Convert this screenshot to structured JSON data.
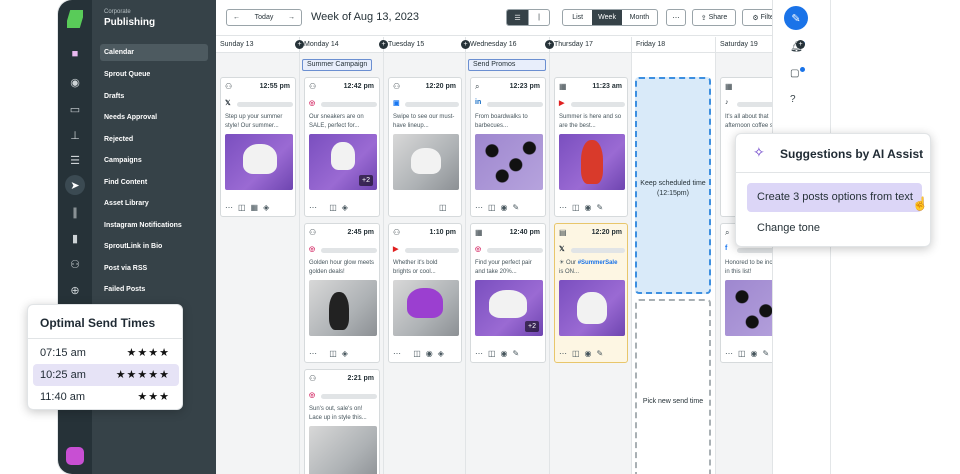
{
  "nav": {
    "org": "Corporate",
    "title": "Publishing",
    "items": [
      "Calendar",
      "Sprout Queue",
      "Drafts",
      "Needs Approval",
      "Rejected",
      "Campaigns",
      "Find Content",
      "Asset Library",
      "Instagram Notifications",
      "SproutLink in Bio",
      "Post via RSS",
      "Failed Posts"
    ]
  },
  "toolbar": {
    "today": "Today",
    "week_label": "Week of Aug 13, 2023",
    "view_list": "List",
    "view_week": "Week",
    "view_month": "Month",
    "share": "Share",
    "filters": "Filters"
  },
  "days": [
    {
      "label": "Sunday 13"
    },
    {
      "label": "Monday 14",
      "tag": "Summer Campaign"
    },
    {
      "label": "Tuesday 15"
    },
    {
      "label": "Wednesday 16",
      "tag": "Send Promos"
    },
    {
      "label": "Thursday 17"
    },
    {
      "label": "Friday 18"
    },
    {
      "label": "Saturday 19"
    }
  ],
  "posts": {
    "sun1": {
      "time": "12:55 pm",
      "network": "𝕏",
      "caption": "Step up your summer style! Our summer..."
    },
    "mon1": {
      "time": "12:42 pm",
      "network": "◎",
      "caption": "Our sneakers are on SALE, perfect for...",
      "more": "+2"
    },
    "mon2": {
      "time": "2:45 pm",
      "network": "◎",
      "caption": "Golden hour glow meets golden deals!"
    },
    "mon3": {
      "time": "2:21 pm",
      "network": "◎",
      "caption": "Sun's out, sale's on! Lace up in style this..."
    },
    "tue1": {
      "time": "12:20 pm",
      "network": "▣",
      "caption": "Swipe to see our must-have lineup..."
    },
    "tue2": {
      "time": "1:10 pm",
      "network": "▶",
      "caption": "Whether it's bold brights or cool..."
    },
    "wed1": {
      "time": "12:23 pm",
      "network": "in",
      "caption": "From boardwalks to barbecues..."
    },
    "wed2": {
      "time": "12:40 pm",
      "network": "◎",
      "caption": "Find your perfect pair and take 20%...",
      "more": "+2"
    },
    "thu1": {
      "time": "11:23 am",
      "network": "▶",
      "caption": "Summer is here and so are the best..."
    },
    "thu2": {
      "time": "12:20 pm",
      "network": "𝕏",
      "caption": "☀ Our ",
      "hashtag": "#SummerSale",
      "caption2": " is ON..."
    },
    "sat1": {
      "time": "",
      "network": "♪",
      "caption": "It's all about that afternoon coffee swirl"
    },
    "sat2": {
      "time": "",
      "network": "f",
      "caption": "Honored to be included in this list!"
    }
  },
  "slots": {
    "keep": "Keep scheduled time (12:15pm)",
    "pick": "Pick new send time"
  },
  "ai": {
    "title": "Suggestions by AI Assist",
    "opt1": "Create 3 posts options from text",
    "opt2": "Change tone"
  },
  "optimal": {
    "title": "Optimal Send Times",
    "rows": [
      {
        "time": "07:15 am",
        "stars": "★★★★"
      },
      {
        "time": "10:25 am",
        "stars": "★★★★★"
      },
      {
        "time": "11:40 am",
        "stars": "★★★"
      }
    ]
  },
  "colors": {
    "accent": "#1a73e8",
    "nav_bg": "#364248",
    "rail_bg": "#263238",
    "ai_highlight": "#dcd6f7"
  }
}
